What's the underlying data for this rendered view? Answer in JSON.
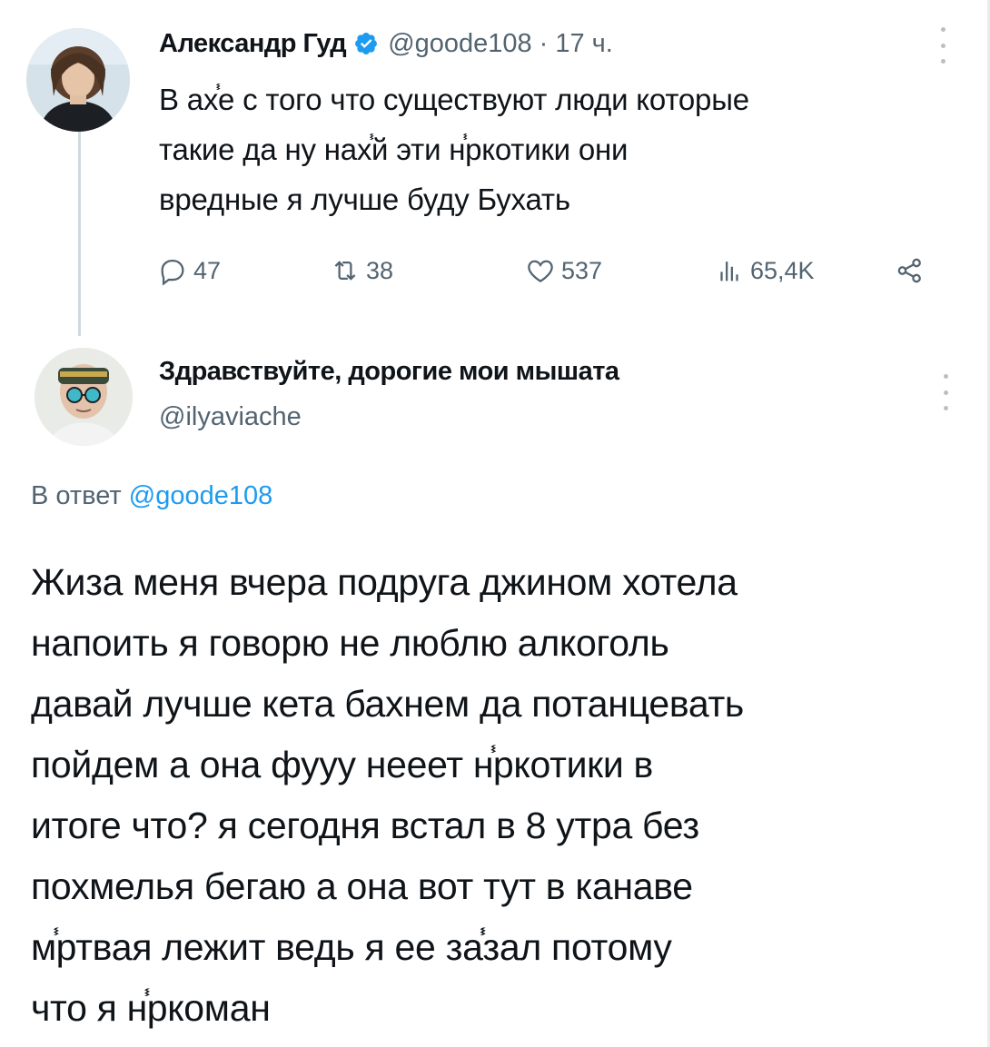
{
  "tweet1": {
    "author_name": "Александр Гуд",
    "handle": "@goode108",
    "separator": "·",
    "time": "17 ч.",
    "text": "В ах֓е с того что существуют люди которые\nтакие да ну нах֓й эти н֓ркотики они\nвредные я лучше буду Бухать",
    "stats": {
      "replies": "47",
      "retweets": "38",
      "likes": "537",
      "views": "65,4K"
    },
    "icons": [
      "verified-badge-icon",
      "more-icon",
      "reply-icon",
      "retweet-icon",
      "like-icon",
      "views-icon",
      "share-icon"
    ]
  },
  "tweet2": {
    "author_name": "Здравствуйте, дорогие мои мышата",
    "handle": "@ilyaviache",
    "reply_prefix": "В ответ",
    "reply_mention": "@goode108",
    "text": "Жиза меня вчера подруга джином хотела\nнапоить я говорю не люблю алкоголь\nдавай лучше кета бахнем да потанцевать\nпойдем а она фууу нееет н֓ркотики в\nитоге что? я сегодня встал в 8 утра без\nпохмелья бегаю а она вот тут в канаве\nм֓ртвая лежит ведь я ее за֓֓зал потому\nчто я н֓ркоман"
  },
  "colors": {
    "text": "#0f1419",
    "secondary": "#536471",
    "accent": "#1d9bf0",
    "thread_line": "#cfd9de"
  }
}
